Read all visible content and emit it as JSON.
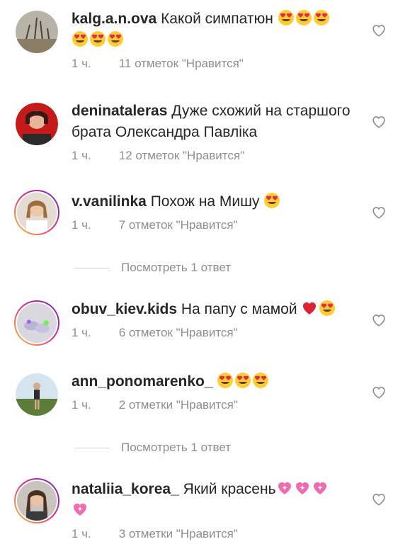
{
  "comments": [
    {
      "username": "kalg.a.n.ova",
      "text": "Какой симпатюн",
      "time": "1 ч.",
      "likes": "11 отметок \"Нравится\""
    },
    {
      "username": "deninataleras",
      "text": "Дуже схожий на старшого брата Олександра Павліка",
      "time": "1 ч.",
      "likes": "12 отметок \"Нравится\""
    },
    {
      "username": "v.vanilinka",
      "text": "Похож на Мишу",
      "time": "1 ч.",
      "likes": "7 отметок \"Нравится\""
    },
    {
      "username": "obuv_kiev.kids",
      "text": "На папу с мамой",
      "time": "1 ч.",
      "likes": "6 отметок \"Нравится\""
    },
    {
      "username": "ann_ponomarenko_",
      "text": "",
      "time": "1 ч.",
      "likes": "2 отметки \"Нравится\""
    },
    {
      "username": "nataliia_korea_",
      "text": "Який красень",
      "time": "1 ч.",
      "likes": "3 отметки \"Нравится\""
    }
  ],
  "view_replies": [
    "Посмотреть 1 ответ",
    "Посмотреть 1 ответ"
  ],
  "icons": {
    "like": "heart-outline-icon",
    "emoji_love": "heart-eyes-emoji",
    "emoji_red_heart": "red-heart-emoji",
    "emoji_sparkle_heart": "sparkling-heart-emoji"
  },
  "colors": {
    "meta": "#8e8e8e",
    "text": "#262626",
    "ring_start": "#f9ce34",
    "ring_end": "#6228d7"
  }
}
